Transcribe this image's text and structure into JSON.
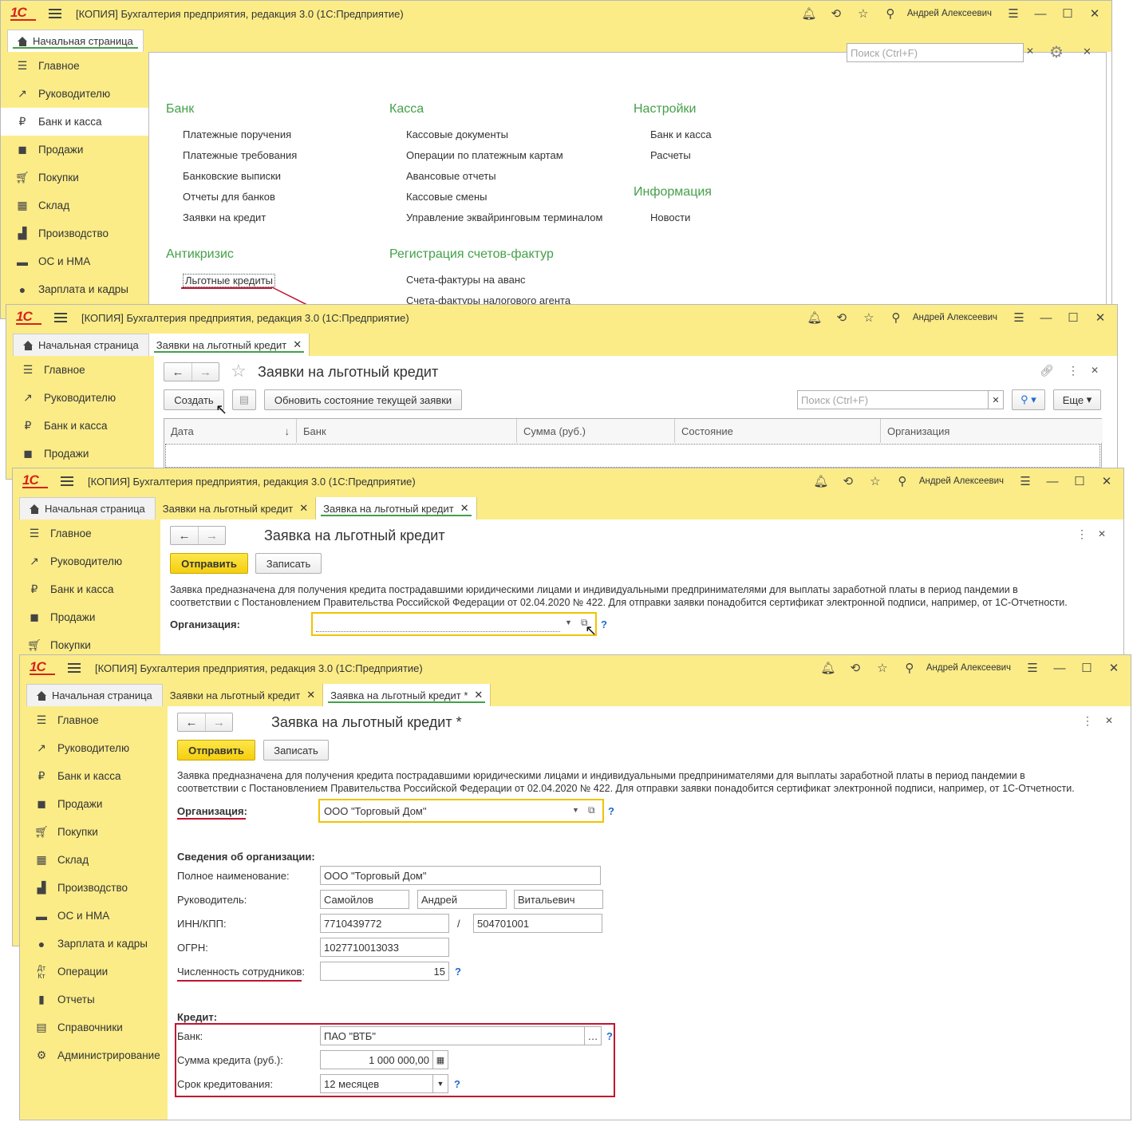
{
  "app_title": "[КОПИЯ] Бухгалтерия предприятия, редакция 3.0  (1С:Предприятие)",
  "logo_text": "1С",
  "user": "Андрей Алексеевич",
  "home_tab": "Начальная страница",
  "sidebar": [
    "Главное",
    "Руководителю",
    "Банк и касса",
    "Продажи",
    "Покупки",
    "Склад",
    "Производство",
    "ОС и НМА",
    "Зарплата и кадры",
    "Операции",
    "Отчеты",
    "Справочники",
    "Администрирование"
  ],
  "sidebar_icons": [
    "menu-lines-icon",
    "trend-icon",
    "ruble-icon",
    "bag-icon",
    "cart-icon",
    "grid-icon",
    "factory-icon",
    "truck-icon",
    "person-icon",
    "dt-kt-icon",
    "bar-chart-icon",
    "book-icon",
    "gear-icon"
  ],
  "w1": {
    "search_placeholder": "Поиск (Ctrl+F)",
    "sections": {
      "bank": {
        "title": "Банк",
        "items": [
          "Платежные поручения",
          "Платежные требования",
          "Банковские выписки",
          "Отчеты для банков",
          "Заявки на кредит"
        ]
      },
      "kassa": {
        "title": "Касса",
        "items": [
          "Кассовые документы",
          "Операции по платежным картам",
          "Авансовые отчеты",
          "Кассовые смены",
          "Управление эквайринговым терминалом"
        ]
      },
      "settings": {
        "title": "Настройки",
        "items": [
          "Банк и касса",
          "Расчеты"
        ]
      },
      "info": {
        "title": "Информация",
        "items": [
          "Новости"
        ]
      },
      "anticrisis": {
        "title": "Антикризис",
        "items": [
          "Льготные кредиты"
        ]
      },
      "invoices": {
        "title": "Регистрация счетов-фактур",
        "items": [
          "Счета-фактуры на аванс",
          "Счета-фактуры налогового агента"
        ]
      }
    }
  },
  "w2": {
    "tab": "Заявки на льготный кредит",
    "title": "Заявки на льготный кредит",
    "create": "Создать",
    "refresh": "Обновить состояние текущей заявки",
    "search_placeholder": "Поиск (Ctrl+F)",
    "more": "Еще",
    "columns": [
      "Дата",
      "Банк",
      "Сумма (руб.)",
      "Состояние",
      "Организация"
    ]
  },
  "w3": {
    "tab1": "Заявки на льготный кредит",
    "tab2": "Заявка на льготный кредит",
    "title": "Заявка на льготный кредит",
    "send": "Отправить",
    "save": "Записать",
    "desc1": "Заявка предназначена для получения кредита пострадавшими юридическими лицами и индивидуальными предпринимателями для выплаты заработной платы в период пандемии в",
    "desc2": "соответствии с Постановлением Правительства Российской Федерации от 02.04.2020 № 422. Для отправки заявки понадобится сертификат электронной подписи, например, от 1С-Отчетности.",
    "org_label": "Организация:",
    "help": "?"
  },
  "w4": {
    "tab1": "Заявки на льготный кредит",
    "tab2": "Заявка на льготный кредит *",
    "title": "Заявка на льготный кредит *",
    "send": "Отправить",
    "save": "Записать",
    "org_label": "Организация:",
    "org_value": "ООО \"Торговый Дом\"",
    "org_info_title": "Сведения об организации:",
    "full_name_label": "Полное наименование:",
    "full_name": "ООО \"Торговый Дом\"",
    "head_label": "Руководитель:",
    "last_name": "Самойлов",
    "first_name": "Андрей",
    "middle_name": "Витальевич",
    "inn_label": "ИНН/КПП:",
    "inn": "7710439772",
    "slash": "/",
    "kpp": "504701001",
    "ogrn_label": "ОГРН:",
    "ogrn": "1027710013033",
    "staff_label": "Численность сотрудников:",
    "staff": "15",
    "credit_title": "Кредит:",
    "bank_label": "Банк:",
    "bank": "ПАО \"ВТБ\"",
    "sum_label": "Сумма кредита (руб.):",
    "sum": "1 000 000,00",
    "term_label": "Срок кредитования:",
    "term": "12 месяцев",
    "help": "?"
  },
  "colors": {
    "titlebar": "#fbec88",
    "green": "#44a049",
    "red_underline": "#c4122f",
    "field_focus": "#f2c300"
  }
}
